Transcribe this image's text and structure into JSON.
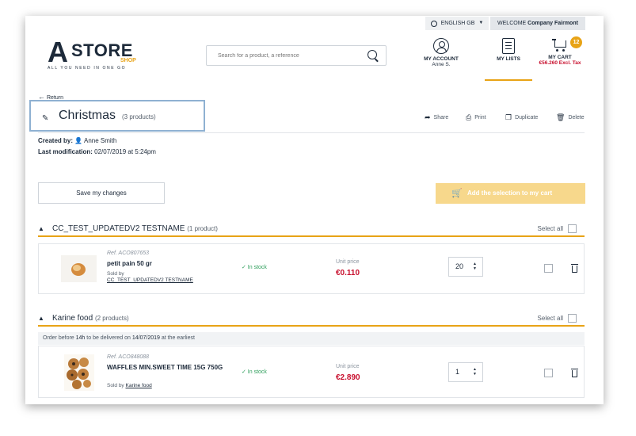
{
  "top_bar": {
    "language": "ENGLISH GB",
    "welcome_prefix": "WELCOME",
    "company": "Company Fairmont"
  },
  "logo": {
    "letter": "A",
    "name": "STORE",
    "sub": "SHOP",
    "tagline": "ALL YOU NEED IN ONE GO"
  },
  "search": {
    "placeholder": "Search for a product, a reference"
  },
  "nav": {
    "account": {
      "label": "MY ACCOUNT",
      "user": "Anne S."
    },
    "lists": {
      "label": "MY LISTS"
    },
    "cart": {
      "label": "MY CART",
      "count": "12",
      "total": "€56.260 Excl. Tax"
    }
  },
  "page": {
    "return_label": "Return",
    "title": "Christmas",
    "title_count": "(3 products)",
    "actions": {
      "share": "Share",
      "print": "Print",
      "duplicate": "Duplicate",
      "delete": "Delete"
    },
    "created_label": "Created by:",
    "created_by": "Anne Smith",
    "modified_label": "Last modification:",
    "modified_value": "02/07/2019 at 5:24pm",
    "save_button": "Save my changes",
    "add_selection_button": "Add the selection to my cart"
  },
  "sections": [
    {
      "title": "CC_TEST_UPDATEDV2 TESTNAME",
      "count": "(1 product)",
      "select_all": "Select all",
      "items": [
        {
          "ref": "Ref. ACO807653",
          "name": "petit pain 50 gr",
          "sold_by_label": "Sold by",
          "seller": "CC_TEST_UPDATEDV2 TESTNAME",
          "stock": "✓ In stock",
          "unit_label": "Unit price",
          "price": "€0.110",
          "qty": "20"
        }
      ]
    },
    {
      "title": "Karine food",
      "count": "(2 products)",
      "select_all": "Select all",
      "delivery": {
        "before": "Order before",
        "hour": "14h",
        "mid": "to be delivered on",
        "date": "14/07/2019",
        "after": "at the earliest"
      },
      "items": [
        {
          "ref": "Ref. ACO848088",
          "name": "WAFFLES MIN.SWEET TIME 15G 750G",
          "sold_by_label": "Sold by",
          "seller": "Karine food",
          "stock": "✓ In stock",
          "unit_label": "Unit price",
          "price": "€2.890",
          "qty": "1"
        }
      ]
    }
  ],
  "colors": {
    "accent": "#e8a316",
    "price": "#c8102e",
    "stock": "#2e9e5b",
    "highlight_box": "#8fb1d2",
    "text": "#1d2a3a"
  }
}
